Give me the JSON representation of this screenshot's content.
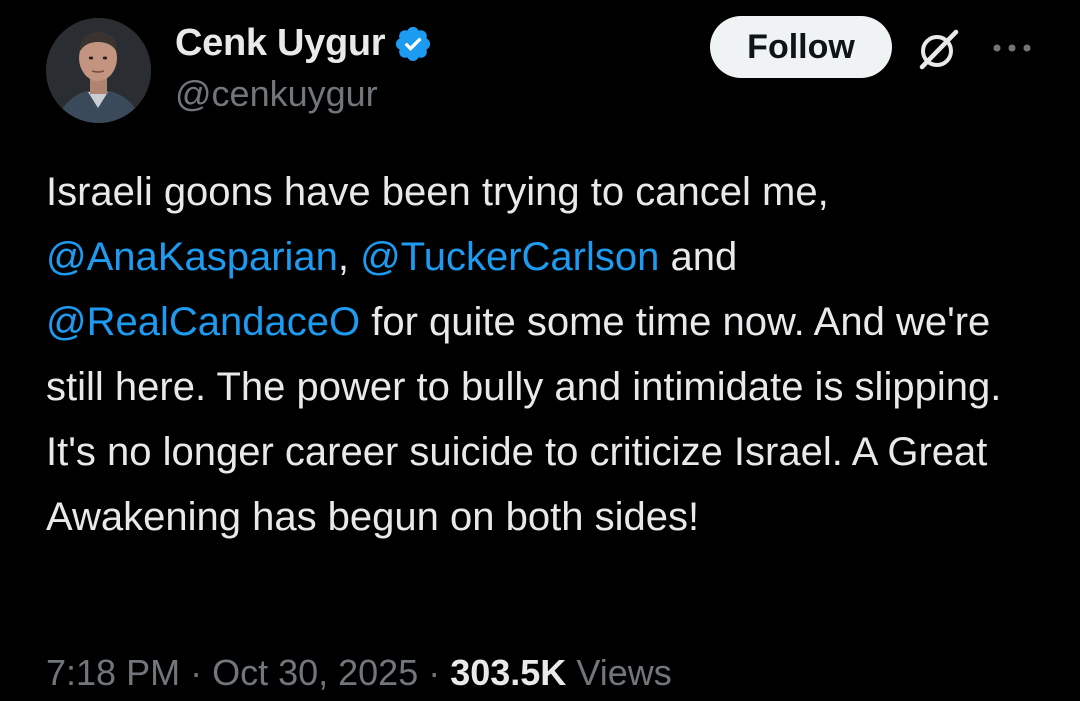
{
  "author": {
    "display_name": "Cenk Uygur",
    "handle": "@cenkuygur",
    "verified": true,
    "avatar_alt": "profile photo"
  },
  "actions": {
    "follow_label": "Follow",
    "grok_icon": "grok-slash-icon",
    "more_icon": "more-horizontal-icon"
  },
  "tweet": {
    "segments": [
      {
        "type": "text",
        "value": "Israeli goons have been trying to cancel me, "
      },
      {
        "type": "mention",
        "value": "@AnaKasparian"
      },
      {
        "type": "text",
        "value": ", "
      },
      {
        "type": "mention",
        "value": "@TuckerCarlson"
      },
      {
        "type": "text",
        "value": " and "
      },
      {
        "type": "mention",
        "value": "@RealCandaceO"
      },
      {
        "type": "text",
        "value": " for quite some time now. And we're still here. The power to bully and intimidate is slipping. It's no longer career suicide to criticize Israel. A Great Awakening has begun on both sides!"
      }
    ]
  },
  "meta": {
    "time": "7:18 PM",
    "separator": " · ",
    "date": "Oct 30, 2025",
    "views_count": "303.5K",
    "views_label": "Views"
  },
  "colors": {
    "background": "#000000",
    "text": "#e7e9ea",
    "muted": "#71767b",
    "link": "#1d9bf0",
    "verified_badge": "#1d9bf0",
    "follow_bg": "#eff3f4"
  }
}
